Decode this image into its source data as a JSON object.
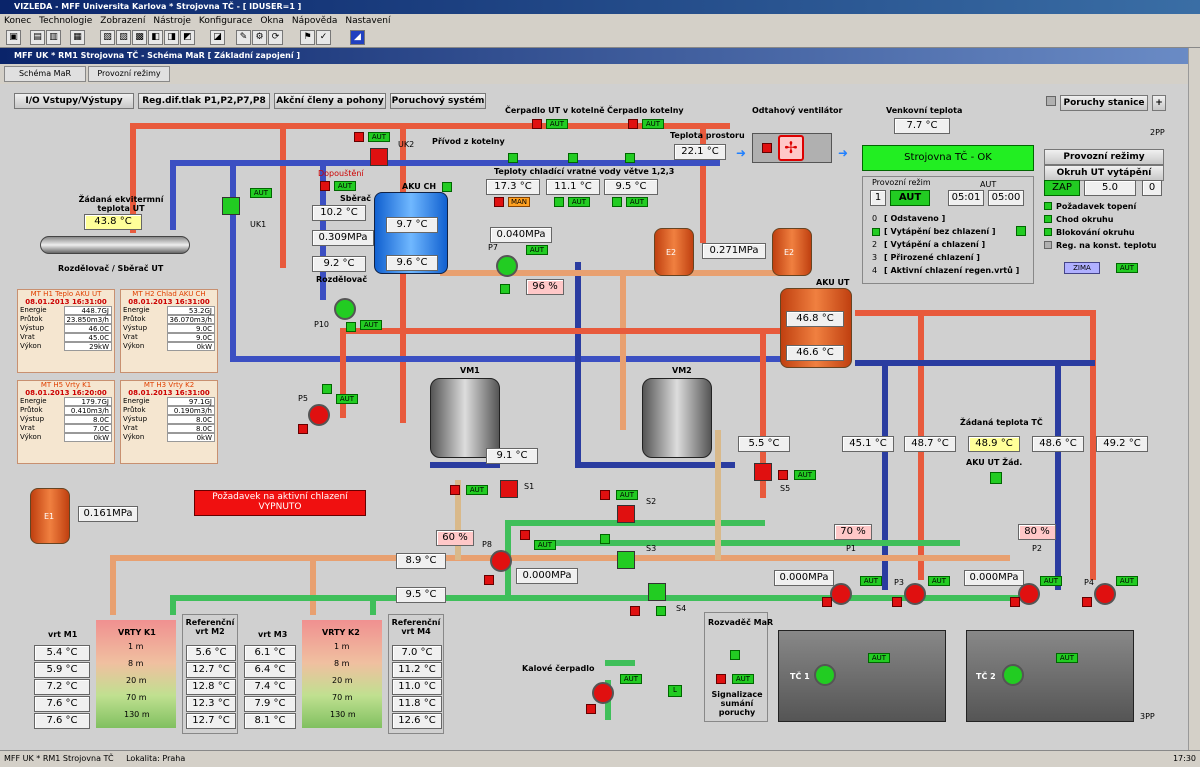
{
  "window": {
    "title": "VIZLEDA - MFF Universita Karlova * Strojovna TČ - [ IDUSER=1 ]",
    "subtitle": "MFF UK * RM1 Strojovna TČ - Schéma MaR [ Základní zapojení ]"
  },
  "menu": [
    "Konec",
    "Technologie",
    "Zobrazení",
    "Nástroje",
    "Konfigurace",
    "Okna",
    "Nápověda",
    "Nastavení"
  ],
  "tabs": [
    "Schéma MaR",
    "Provozní režimy"
  ],
  "nav_buttons": [
    "I/O Vstupy/Výstupy",
    "Reg.dif.tlak P1,P2,P7,P8",
    "Akční členy a pohony",
    "Poruchový systém"
  ],
  "poruchy": {
    "label": "Poruchy stanice",
    "plus": "+",
    "code": "2PP"
  },
  "labels": {
    "cerpadlo_ut": "Čerpadlo UT v kotelně",
    "cerpadlo_kot": "Čerpadlo kotelny",
    "odtah": "Odtahový ventilátor",
    "venkovni": "Venkovní teplota",
    "teplota_prostoru": "Teplota prostoru",
    "privod": "Přívod z kotelny",
    "uk2": "UK2",
    "uk1": "UK1",
    "dopousteni": "Dopouštění",
    "akuch": "AKU CH",
    "sberac": "Sběrač",
    "rozdelovac": "Rozdělovač",
    "zadana_ekv": "Žádaná ekvitermní teplota UT",
    "rozd_sberac": "Rozdělovač / Sběrač UT",
    "teploty_chl": "Teploty chladící vratné vody větve 1,2,3",
    "man": "MAN",
    "p7": "P7",
    "p10": "P10",
    "p5": "P5",
    "p8": "P8",
    "e1": "E1",
    "e2": "E2",
    "aku_ut": "AKU UT",
    "vm1": "VM1",
    "vm2": "VM2",
    "s1": "S1",
    "s2": "S2",
    "s3": "S3",
    "s4": "S4",
    "s5": "S5",
    "p1": "P1",
    "p2": "P2",
    "p3": "P3",
    "p4": "P4",
    "tc1": "TČ 1",
    "tc2": "TČ 2",
    "zadana_tc": "Žádaná teplota TČ",
    "aku_zad": "AKU UT Žád.",
    "kalove": "Kalové čerpadlo",
    "rozvadec": "Rozvaděč MaR",
    "signal": "Signalizace sumání poruchy",
    "l": "L",
    "pp": "3PP",
    "vrty_k1": "VRTY K1",
    "vrty_k2": "VRTY K2",
    "ref_m2": "Referenční vrt M2",
    "ref_m4": "Referenční vrt M4",
    "vt_m1": "vrt M1",
    "vt_m3": "vrt M3",
    "chlaz": "Požadavek na aktivní chlazení VYPNUTO",
    "aut": "AUT"
  },
  "values": {
    "venkovni": "7.7 °C",
    "prostoru": "22.1 °C",
    "ekv": "43.8 °C",
    "sberac_t": "10.2 °C",
    "aku_t1": "9.7 °C",
    "aku_p": "0.309MPa",
    "rozd_t": "9.2 °C",
    "aku_t2": "9.6 °C",
    "chl1": "17.3 °C",
    "chl2": "11.1 °C",
    "chl3": "9.5 °C",
    "p7_p": "0.040MPa",
    "p7_pct": "96 %",
    "e2_p": "0.271MPa",
    "aku_ut1": "46.8 °C",
    "aku_ut2": "46.6 °C",
    "vm1_t": "9.1 °C",
    "s5_t": "5.5 °C",
    "e1_p": "0.161MPa",
    "p8_pct": "60 %",
    "p8_p": "0.000MPa",
    "t89": "8.9 °C",
    "t95": "9.5 °C",
    "v451": "45.1 °C",
    "v487": "48.7 °C",
    "v489": "48.9 °C",
    "v486": "48.6 °C",
    "v492": "49.2 °C",
    "p1_pct": "70 %",
    "p2_pct": "80 %",
    "p3_p": "0.000MPa",
    "p4_p": "0.000MPa"
  },
  "status": {
    "title": "Strojovna TČ - OK",
    "provozni": "Provozní režim",
    "aut_small": "AUT",
    "mode_num": "1",
    "mode": "AUT",
    "t1": "05:01",
    "t2": "05:00",
    "modes": [
      {
        "n": "0",
        "t": "[ Odstaveno ]"
      },
      {
        "n": "1",
        "t": "[ Vytápění bez chlazení ]"
      },
      {
        "n": "2",
        "t": "[ Vytápění a chlazení ]"
      },
      {
        "n": "3",
        "t": "[ Přirozené chlazení ]"
      },
      {
        "n": "4",
        "t": "[ Aktivní chlazení regen.vrtů ]"
      }
    ]
  },
  "right_panel": {
    "rezimy": "Provozní režimy",
    "okruh": "Okruh UT vytápění",
    "zap": "ZAP",
    "val": "5.0",
    "zero": "0",
    "items": [
      "Požadavek topení",
      "Chod okruhu",
      "Blokování okruhu",
      "Reg. na konst. teplotu"
    ],
    "zima": "ZIMA",
    "aut": "AUT"
  },
  "mt_blocks": [
    {
      "h": "MT H1 Teplo AKU UT",
      "d": "08.01.2013 16:31:00",
      "rows": [
        [
          "Energie",
          "448.7GJ"
        ],
        [
          "Průtok",
          "23.850m3/h"
        ],
        [
          "Výstup",
          "46.0C"
        ],
        [
          "Vrat",
          "45.0C"
        ],
        [
          "Výkon",
          "29kW"
        ]
      ]
    },
    {
      "h": "MT H2 Chlad AKU CH",
      "d": "08.01.2013 16:31:00",
      "rows": [
        [
          "Energie",
          "53.2GJ"
        ],
        [
          "Průtok",
          "36.070m3/h"
        ],
        [
          "Výstup",
          "9.0C"
        ],
        [
          "Vrat",
          "9.0C"
        ],
        [
          "Výkon",
          "0kW"
        ]
      ]
    },
    {
      "h": "MT H5 Vrty K1",
      "d": "08.01.2013 16:20:00",
      "rows": [
        [
          "Energie",
          "179.7GJ"
        ],
        [
          "Průtok",
          "0.410m3/h"
        ],
        [
          "Výstup",
          "8.0C"
        ],
        [
          "Vrat",
          "7.0C"
        ],
        [
          "Výkon",
          "0kW"
        ]
      ]
    },
    {
      "h": "MT H3 Vrty K2",
      "d": "08.01.2013 16:31:00",
      "rows": [
        [
          "Energie",
          "97.1GJ"
        ],
        [
          "Průtok",
          "0.190m3/h"
        ],
        [
          "Výstup",
          "8.0C"
        ],
        [
          "Vrat",
          "8.0C"
        ],
        [
          "Výkon",
          "0kW"
        ]
      ]
    }
  ],
  "wells": {
    "m1": [
      "5.4 °C",
      "5.9 °C",
      "7.2 °C",
      "7.6 °C",
      "7.6 °C"
    ],
    "m2": [
      "5.6 °C",
      "12.7 °C",
      "12.8 °C",
      "12.3 °C",
      "12.7 °C"
    ],
    "m3": [
      "6.1 °C",
      "6.4 °C",
      "7.4 °C",
      "7.9 °C",
      "8.1 °C"
    ],
    "m4": [
      "7.0 °C",
      "11.2 °C",
      "11.0 °C",
      "11.8 °C",
      "12.6 °C"
    ],
    "depth": [
      "1 m",
      "8 m",
      "20 m",
      "70 m",
      "130 m"
    ]
  },
  "statusbar": {
    "left": "MFF UK * RM1 Strojovna TČ",
    "loc": "Lokalita: Praha",
    "right": "17:30"
  }
}
